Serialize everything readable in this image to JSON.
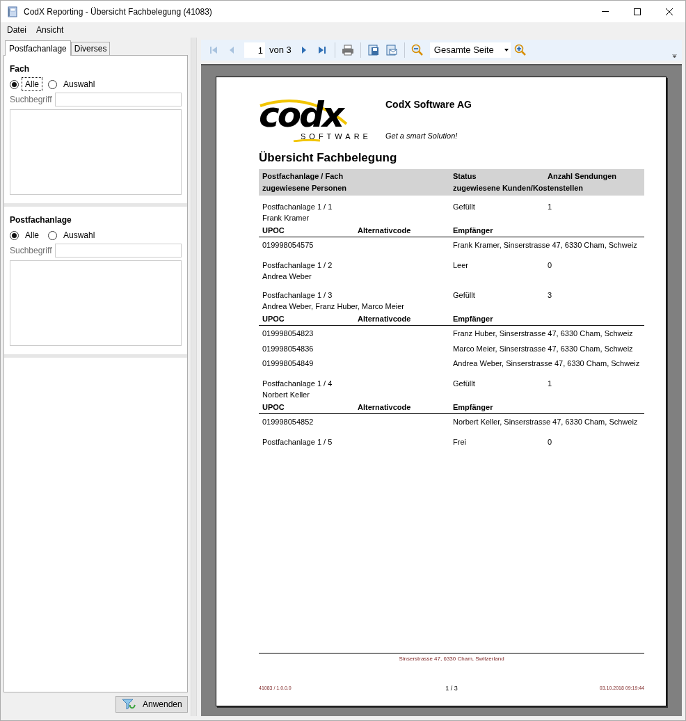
{
  "window": {
    "title": "CodX Reporting - Übersicht Fachbelegung (41083)"
  },
  "menu": [
    "Datei",
    "Ansicht"
  ],
  "tabs": [
    {
      "label": "Postfachanlage",
      "selected": true
    },
    {
      "label": "Diverses",
      "selected": false
    }
  ],
  "filters": [
    {
      "title": "Fach",
      "radios": [
        {
          "label": "Alle",
          "selected": true,
          "focused": true
        },
        {
          "label": "Auswahl",
          "selected": false,
          "focused": false
        }
      ],
      "search_label": "Suchbegriff"
    },
    {
      "title": "Postfachanlage",
      "radios": [
        {
          "label": "Alle",
          "selected": true,
          "focused": false
        },
        {
          "label": "Auswahl",
          "selected": false,
          "focused": false
        }
      ],
      "search_label": "Suchbegriff"
    }
  ],
  "apply_button": "Anwenden",
  "toolbar": {
    "page": "1",
    "page_count": "von 3",
    "zoom": "Gesamte Seite",
    "first_enabled": false,
    "prev_enabled": false
  },
  "report": {
    "logo": {
      "wordmark": "codx",
      "tagline": "SOFTWARE"
    },
    "company": "CodX Software AG",
    "slogan": "Get a smart Solution!",
    "title": "Übersicht Fachbelegung",
    "header": [
      [
        "Postfachanlage / Fach",
        "Status",
        "Anzahl Sendungen"
      ],
      [
        "zugewiesene Personen",
        "zugewiesene Kunden/Kostenstellen"
      ]
    ],
    "groups": [
      {
        "fach": "Postfachanlage 1 / 1",
        "persons": "Frank Kramer",
        "status": "Gefüllt",
        "count": "1",
        "item_columns": [
          "UPOC",
          "Alternativcode",
          "Empfänger"
        ],
        "items": [
          {
            "upoc": "019998054575",
            "recipient": "Frank Kramer, Sinserstrasse 47, 6330 Cham, Schweiz"
          }
        ]
      },
      {
        "fach": "Postfachanlage 1 / 2",
        "persons": "Andrea Weber",
        "status": "Leer",
        "count": "0"
      },
      {
        "fach": "Postfachanlage 1 / 3",
        "persons": "Andrea Weber, Franz Huber, Marco Meier",
        "status": "Gefüllt",
        "count": "3",
        "item_columns": [
          "UPOC",
          "Alternativcode",
          "Empfänger"
        ],
        "items": [
          {
            "upoc": "019998054823",
            "recipient": "Franz Huber, Sinserstrasse 47, 6330 Cham, Schweiz"
          },
          {
            "upoc": "019998054836",
            "recipient": "Marco Meier, Sinserstrasse 47, 6330 Cham, Schweiz"
          },
          {
            "upoc": "019998054849",
            "recipient": "Andrea Weber, Sinserstrasse 47, 6330 Cham, Schweiz"
          }
        ]
      },
      {
        "fach": "Postfachanlage 1 / 4",
        "persons": "Norbert Keller",
        "status": "Gefüllt",
        "count": "1",
        "item_columns": [
          "UPOC",
          "Alternativcode",
          "Empfänger"
        ],
        "items": [
          {
            "upoc": "019998054852",
            "recipient": "Norbert Keller, Sinserstrasse 47, 6330 Cham, Schweiz"
          }
        ]
      },
      {
        "fach": "Postfachanlage 1 / 5",
        "status": "Frei",
        "count": "0"
      }
    ],
    "footer_address": "Sinserstrasse 47, 6330 Cham, Switzerland",
    "footer_left": "41083 / 1.0.0.0",
    "footer_center": "1 / 3",
    "footer_right": "03.10.2018 09:19:44"
  }
}
